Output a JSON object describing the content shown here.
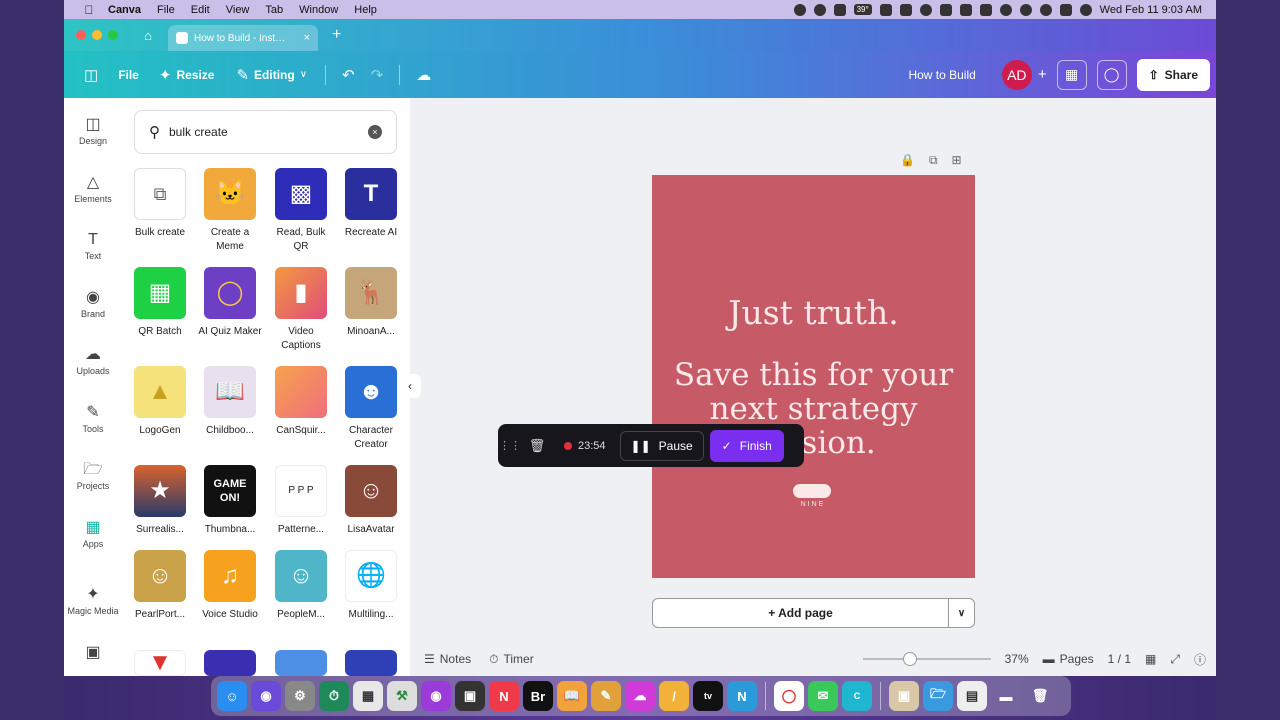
{
  "menubar": {
    "app_name": "Canva",
    "items": [
      "File",
      "Edit",
      "View",
      "Tab",
      "Window",
      "Help"
    ],
    "temp_badge": "39°",
    "datetime": "Wed Feb 11  9:03 AM"
  },
  "browser": {
    "tab_title": "How to Build - Inst…"
  },
  "toolbar": {
    "file": "File",
    "resize": "Resize",
    "editing": "Editing",
    "doc_title": "How to Build",
    "avatar_initials": "AD",
    "share": "Share"
  },
  "rail": {
    "items": [
      {
        "label": "Design",
        "icon": "design-icon"
      },
      {
        "label": "Elements",
        "icon": "elements-icon"
      },
      {
        "label": "Text",
        "icon": "text-icon"
      },
      {
        "label": "Brand",
        "icon": "brand-icon"
      },
      {
        "label": "Uploads",
        "icon": "uploads-icon"
      },
      {
        "label": "Tools",
        "icon": "tools-icon"
      },
      {
        "label": "Projects",
        "icon": "projects-icon"
      },
      {
        "label": "Apps",
        "icon": "apps-icon"
      },
      {
        "label": "Magic Media",
        "icon": "magic-media-icon"
      }
    ]
  },
  "search": {
    "value": "bulk create"
  },
  "apps": [
    {
      "label": "Bulk create"
    },
    {
      "label": "Create a Meme"
    },
    {
      "label": "Read, Bulk QR"
    },
    {
      "label": "Recreate AI"
    },
    {
      "label": "QR Batch"
    },
    {
      "label": "AI Quiz Maker"
    },
    {
      "label": "Video Captions"
    },
    {
      "label": "MinoanA..."
    },
    {
      "label": "LogoGen"
    },
    {
      "label": "Childboo..."
    },
    {
      "label": "CanSquir..."
    },
    {
      "label": "Character Creator"
    },
    {
      "label": "Surrealis..."
    },
    {
      "label": "Thumbna..."
    },
    {
      "label": "Patterne..."
    },
    {
      "label": "LisaAvatar"
    },
    {
      "label": "PearlPort..."
    },
    {
      "label": "Voice Studio"
    },
    {
      "label": "PeopleM..."
    },
    {
      "label": "Multiling..."
    }
  ],
  "design": {
    "line1": "Just truth.",
    "line2": "Save this for your next strategy session.",
    "logo_text": "NINE",
    "bg_color": "#c65b67"
  },
  "add_page": "+ Add page",
  "recorder": {
    "time": "23:54",
    "pause": "Pause",
    "finish": "Finish"
  },
  "bottombar": {
    "notes": "Notes",
    "timer": "Timer",
    "zoom": "37%",
    "zoom_fraction": 0.37,
    "pages": "Pages",
    "page_count": "1 / 1"
  }
}
